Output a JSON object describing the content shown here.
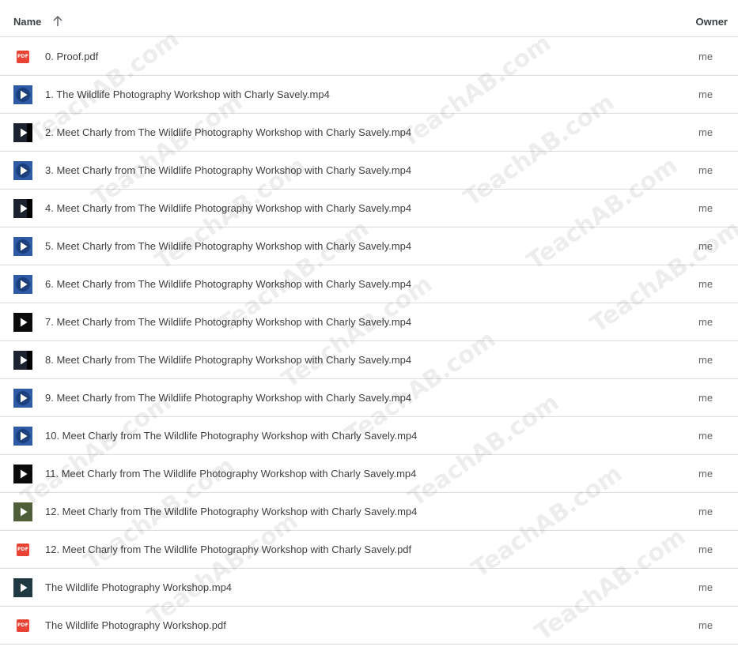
{
  "header": {
    "name_label": "Name",
    "owner_label": "Owner",
    "sort": "ascending"
  },
  "watermark_text": "TeachAB.com",
  "files": [
    {
      "name": "0. Proof.pdf",
      "type": "pdf",
      "owner": "me"
    },
    {
      "name": "1. The Wildlife Photography Workshop with Charly Savely.mp4",
      "type": "video",
      "thumb": "blue",
      "owner": "me"
    },
    {
      "name": "2. Meet Charly from The Wildlife Photography Workshop with Charly Savely.mp4",
      "type": "video",
      "thumb": "dark",
      "owner": "me"
    },
    {
      "name": "3. Meet Charly from The Wildlife Photography Workshop with Charly Savely.mp4",
      "type": "video",
      "thumb": "blue",
      "owner": "me"
    },
    {
      "name": "4. Meet Charly from The Wildlife Photography Workshop with Charly Savely.mp4",
      "type": "video",
      "thumb": "dark",
      "owner": "me"
    },
    {
      "name": "5. Meet Charly from The Wildlife Photography Workshop with Charly Savely.mp4",
      "type": "video",
      "thumb": "blue",
      "owner": "me"
    },
    {
      "name": "6. Meet Charly from The Wildlife Photography Workshop with Charly Savely.mp4",
      "type": "video",
      "thumb": "blue",
      "owner": "me"
    },
    {
      "name": "7. Meet Charly from The Wildlife Photography Workshop with Charly Savely.mp4",
      "type": "video",
      "thumb": "black",
      "owner": "me"
    },
    {
      "name": "8. Meet Charly from The Wildlife Photography Workshop with Charly Savely.mp4",
      "type": "video",
      "thumb": "dark",
      "owner": "me"
    },
    {
      "name": "9. Meet Charly from The Wildlife Photography Workshop with Charly Savely.mp4",
      "type": "video",
      "thumb": "blue",
      "owner": "me"
    },
    {
      "name": "10. Meet Charly from The Wildlife Photography Workshop with Charly Savely.mp4",
      "type": "video",
      "thumb": "blue",
      "owner": "me"
    },
    {
      "name": "11. Meet Charly from The Wildlife Photography Workshop with Charly Savely.mp4",
      "type": "video",
      "thumb": "black",
      "owner": "me"
    },
    {
      "name": "12. Meet Charly from The Wildlife Photography Workshop with Charly Savely.mp4",
      "type": "video",
      "thumb": "nature",
      "owner": "me"
    },
    {
      "name": "12. Meet Charly from The Wildlife Photography Workshop with Charly Savely.pdf",
      "type": "pdf",
      "owner": "me"
    },
    {
      "name": "The Wildlife Photography Workshop.mp4",
      "type": "video",
      "thumb": "teal",
      "owner": "me"
    },
    {
      "name": "The Wildlife Photography Workshop.pdf",
      "type": "pdf",
      "owner": "me"
    }
  ],
  "icons": {
    "pdf": "pdf-file-icon",
    "video": "video-file-icon",
    "sort": "arrow-up-icon"
  },
  "colors": {
    "pdf_red": "#ea4335",
    "thumb_blue": "#2f5aa6",
    "thumb_dark": "#1b2230",
    "thumb_black": "#0b0b0b",
    "thumb_teal": "#1f3a42",
    "thumb_nature": "#4f5f3a"
  }
}
